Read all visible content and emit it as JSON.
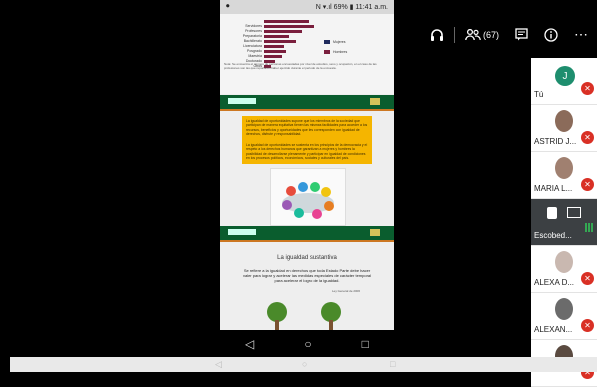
{
  "phone": {
    "status_left": "⏺",
    "status_right": "N ▾.ıl 69% ▮ 11:41 a.m.",
    "chart_rows": [
      {
        "label": "",
        "v1": 0.5
      },
      {
        "label": "Servidores",
        "v1": 0.55
      },
      {
        "label": "Profesores",
        "v1": 0.42
      },
      {
        "label": "Preparatoria",
        "v1": 0.28
      },
      {
        "label": "Bachillerato",
        "v1": 0.36
      },
      {
        "label": "Licenciatura",
        "v1": 0.22
      },
      {
        "label": "Posgrado",
        "v1": 0.24
      },
      {
        "label": "Maestría",
        "v1": 0.2
      },
      {
        "label": "Doctorado",
        "v1": 0.12
      },
      {
        "label": "Otros",
        "v1": 0.08
      }
    ],
    "legend": [
      "Mujeres",
      "Hombres"
    ],
    "legend_colors": [
      "#1f2a5c",
      "#7a1f3d"
    ],
    "note": "Nota: Se encuentra el número de personas encuestadas por nivel de estudios, sexo y ocupación, en el caso de las profesiones son las que reportaron haber ejercido durante el periodo de la encuesta.",
    "yellow_1": "La igualdad de oportunidades supone que los miembros de la sociedad que participan de manera equitativa tienen las mismas facilidades para acceder a los recursos, beneficios y oportunidades que les corresponden con igualdad de derechos, disfrute y responsabilidad.",
    "yellow_2": "La igualdad de oportunidades se sustenta en los principios de la democracia y el respeto a los derechos humanos que garantizan a mujeres y hombres la posibilidad de desarrollarse plenamente y participar en igualdad de condiciones en los procesos políticos, económicos, sociales y culturales del país.",
    "section_title": "La igualdad sustantiva",
    "paragraph": "Se refiere a la igualdad en derechos que toda Estado Parte debe hacer valer para lograr y acelerar las medidas especiales de carácter temporal para acelerar el logro de la igualdad.",
    "citation": "Ley General de 2006",
    "nav": [
      "◁",
      "○",
      "□"
    ]
  },
  "toolbar": {
    "headset_icon": "🎧",
    "participants_label": "(67)",
    "chat_icon": "▤",
    "info_icon": "ⓘ",
    "more_icon": "⋯"
  },
  "participants": [
    {
      "name": "Tú",
      "initial": "J",
      "color": "#1e8e6e",
      "muted": true
    },
    {
      "name": "ASTRID J...",
      "color": "#8b6b5a",
      "muted": true
    },
    {
      "name": "MARIA L...",
      "color": "#a08070",
      "muted": true
    },
    {
      "name": "Escobed...",
      "color": "#3c4043",
      "muted": false,
      "presenting": true
    },
    {
      "name": "ALEXA D...",
      "color": "#c9b8b0",
      "muted": true
    },
    {
      "name": "ALEXAN...",
      "color": "#6b6b6b",
      "muted": true
    },
    {
      "name": "",
      "color": "#5a4a40",
      "muted": true
    }
  ]
}
